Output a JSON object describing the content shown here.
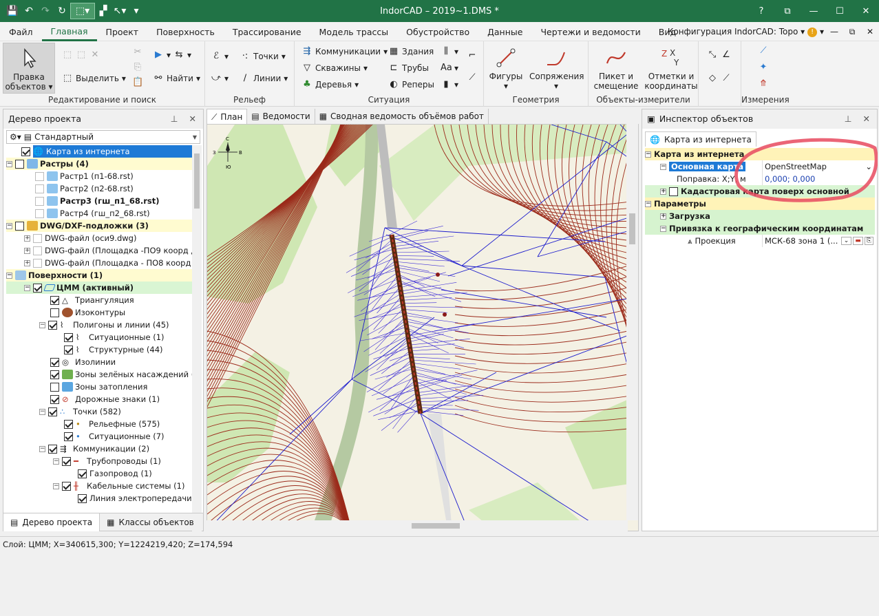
{
  "window": {
    "title": "IndorCAD – 2019~1.DMS *"
  },
  "menu": [
    "Файл",
    "Главная",
    "Проект",
    "Поверхность",
    "Трассирование",
    "Модель трассы",
    "Обустройство",
    "Данные",
    "Чертежи и ведомости",
    "Вид"
  ],
  "config_label": "Конфигурация IndorCAD: Topo",
  "ribbon": {
    "edit": {
      "edit_objects": "Правка объектов",
      "select": "Выделить",
      "group": "Редактирование и поиск"
    },
    "find": "Найти",
    "relief": {
      "points": "Точки",
      "lines": "Линии",
      "group": "Рельеф"
    },
    "situation": {
      "communications": "Коммуникации",
      "wells": "Скважины",
      "trees": "Деревья",
      "buildings": "Здания",
      "pipes": "Трубы",
      "benchmarks": "Реперы",
      "group": "Ситуация"
    },
    "geometry": {
      "figures": "Фигуры",
      "junctions": "Сопряжения",
      "group": "Геометрия"
    },
    "measure_objects": {
      "picket": "Пикет и смещение",
      "marks": "Отметки и координаты",
      "group": "Объекты-измерители"
    },
    "measurements": {
      "group": "Измерения"
    }
  },
  "project_tree": {
    "title": "Дерево проекта",
    "filter": "Стандартный",
    "items": [
      "Карта из интернета",
      "Растры (4)",
      "Растр1 (п1-68.rst)",
      "Растр2 (п2-68.rst)",
      "Растр3 (гш_п1_68.rst)",
      "Растр4 (гш_п2_68.rst)",
      "DWG/DXF-подложки (3)",
      "DWG-файл (оси9.dwg)",
      "DWG-файл (Площадка -ПО9  коорд д...",
      "DWG-файл (Площадка - ПО8 коорд д...",
      "Поверхности (1)",
      "ЦММ (активный)",
      "Триангуляция",
      "Изоконтуры",
      "Полигоны и линии (45)",
      "Ситуационные (1)",
      "Структурные (44)",
      "Изолинии",
      "Зоны зелёных насаждений (6)",
      "Зоны затопления",
      "Дорожные знаки (1)",
      "Точки (582)",
      "Рельефные (575)",
      "Ситуационные (7)",
      "Коммуникации (2)",
      "Трубопроводы (1)",
      "Газопровод (1)",
      "Кабельные системы (1)",
      "Линия электропередачи (1)"
    ],
    "tabs": [
      "Дерево проекта",
      "Классы объектов"
    ]
  },
  "doc_tabs": [
    "План",
    "Ведомости",
    "Сводная ведомость объёмов работ"
  ],
  "compass": {
    "n": "С",
    "s": "Ю",
    "e": "В",
    "w": "З"
  },
  "inspector": {
    "title": "Инспектор объектов",
    "tab": "Карта из интернета",
    "rows": {
      "cat_map": "Карта из интернета",
      "base_map_key": "Основная карта",
      "base_map_val": "OpenStreetMap",
      "offset_key": "Поправка: X;Y, м",
      "offset_val": "0,000; 0,000",
      "cadastral": "Кадастровая карта поверх основной",
      "cat_params": "Параметры",
      "loading": "Загрузка",
      "geo_binding": "Привязка к географическим координатам",
      "projection_key": "Проекция",
      "projection_val": "МСК-68 зона 1 (..."
    }
  },
  "status": {
    "text": "Слой: ЦММ; X=340615,300; Y=1224219,420; Z=174,594"
  },
  "colors": {
    "accent": "#217346",
    "selection": "#1e7ad6",
    "network": "#1a1acc",
    "contour": "#9b2a1a"
  }
}
